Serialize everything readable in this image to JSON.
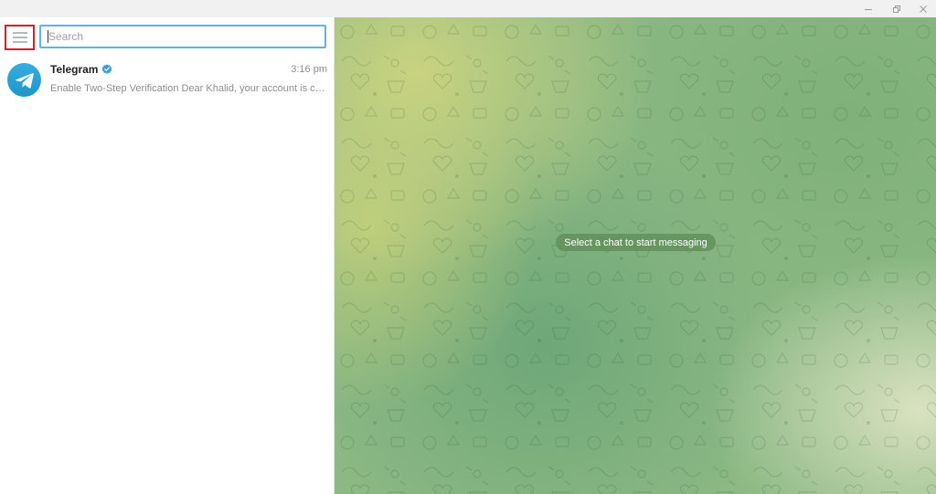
{
  "window": {
    "controls": [
      "minimize-icon",
      "restore-icon",
      "close-icon"
    ]
  },
  "sidebar": {
    "menu_icon": "hamburger-menu-icon",
    "search": {
      "placeholder": "Search",
      "value": ""
    },
    "chats": [
      {
        "name": "Telegram",
        "verified": true,
        "time": "3:16 pm",
        "preview": "Enable Two-Step Verification Dear Khalid, your account is cur...",
        "avatar_icon": "telegram-plane-icon"
      }
    ]
  },
  "main": {
    "empty_message": "Select a chat to start messaging"
  },
  "colors": {
    "accent": "#5db4e3",
    "menu_highlight": "#d0222e",
    "telegram_blue": "#2ea6de",
    "verified": "#3a9be0"
  }
}
